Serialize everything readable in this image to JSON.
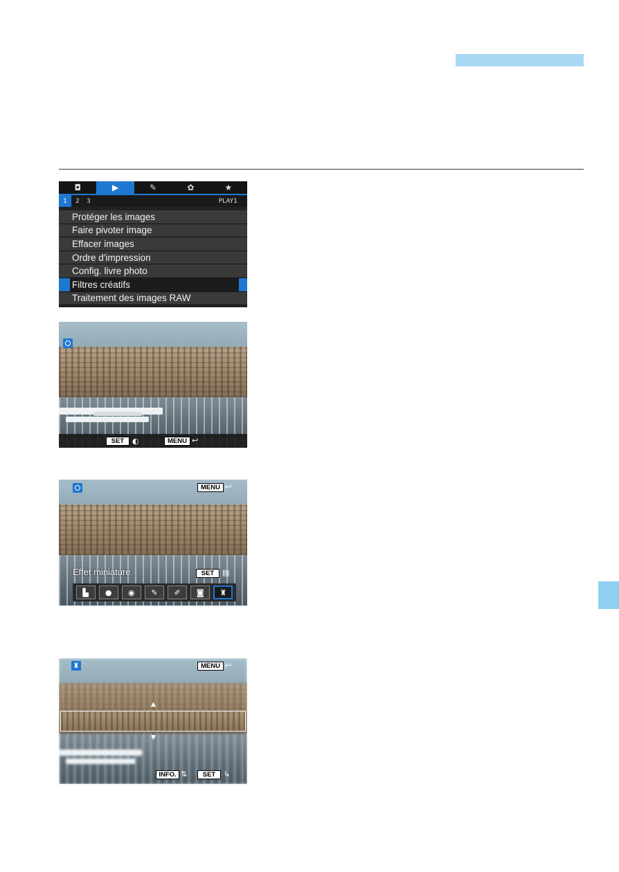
{
  "menu": {
    "tabs": [
      {
        "icon": "camera-icon",
        "glyph": "◘"
      },
      {
        "icon": "playback-icon",
        "glyph": "▶"
      },
      {
        "icon": "wrench-icon",
        "glyph": "✎"
      },
      {
        "icon": "custom-function-icon",
        "glyph": "✿"
      },
      {
        "icon": "my-menu-star-icon",
        "glyph": "★"
      }
    ],
    "pages": [
      "1",
      "2",
      "3"
    ],
    "tab_label": "PLAY1",
    "items": [
      "Protéger les images",
      "Faire pivoter image",
      "Effacer images",
      "Ordre d'impression",
      "Config. livre photo",
      "Filtres créatifs",
      "Traitement des images RAW"
    ],
    "selected_index": 5
  },
  "screen2": {
    "set_label": "SET",
    "menu_label": "MENU",
    "back_glyph": "↩"
  },
  "screen3": {
    "menu_label": "MENU",
    "back_glyph": "↩",
    "effect_name": "Effet miniature",
    "set_label": "SET",
    "effects": [
      {
        "icon": "grainy-bw-icon",
        "glyph": "▙"
      },
      {
        "icon": "soft-focus-icon",
        "glyph": "●"
      },
      {
        "icon": "fisheye-icon",
        "glyph": "◉"
      },
      {
        "icon": "art-bold-icon",
        "glyph": "✎"
      },
      {
        "icon": "water-painting-icon",
        "glyph": "✐"
      },
      {
        "icon": "toy-camera-icon",
        "glyph": "◙"
      },
      {
        "icon": "miniature-icon",
        "glyph": "♜"
      }
    ],
    "active_effect": 6
  },
  "screen4": {
    "menu_label": "MENU",
    "back_glyph": "↩",
    "info_label": "INFO.",
    "set_label": "SET",
    "up_glyph": "▲",
    "down_glyph": "▼"
  },
  "colors": {
    "accent": "#1e78d2",
    "header_bar": "#a9d8f5",
    "side_tab": "#8fd0f2"
  }
}
